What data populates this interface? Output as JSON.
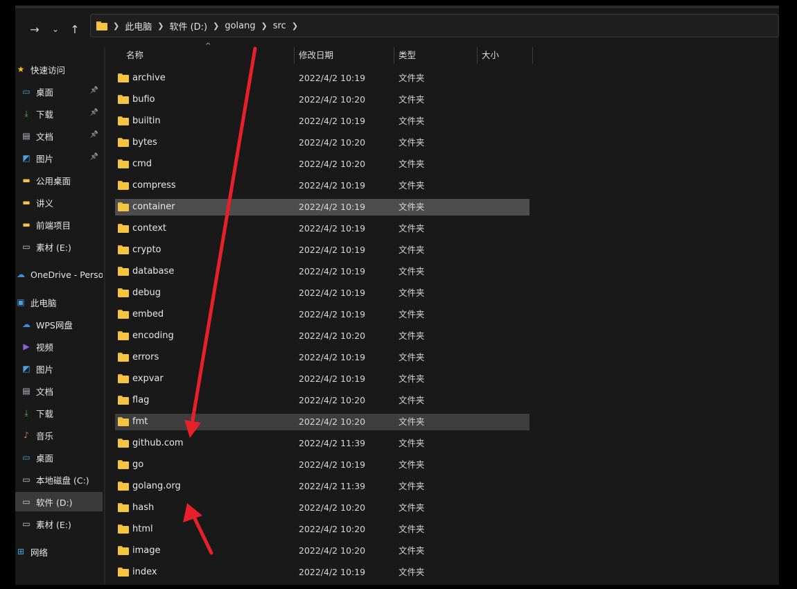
{
  "breadcrumb": [
    "此电脑",
    "软件 (D:)",
    "golang",
    "src"
  ],
  "columns": {
    "name": "名称",
    "modified": "修改日期",
    "type": "类型",
    "size": "大小"
  },
  "sidebar": [
    {
      "label": "快速访问",
      "icon": "star-icon",
      "level": 0,
      "pinned": false
    },
    {
      "label": "桌面",
      "icon": "desktop-icon",
      "level": 1,
      "pinned": true
    },
    {
      "label": "下载",
      "icon": "download-icon",
      "level": 1,
      "pinned": true
    },
    {
      "label": "文档",
      "icon": "document-icon",
      "level": 1,
      "pinned": true
    },
    {
      "label": "图片",
      "icon": "picture-icon",
      "level": 1,
      "pinned": true
    },
    {
      "label": "公用桌面",
      "icon": "folder-icon",
      "level": 1,
      "pinned": false
    },
    {
      "label": "讲义",
      "icon": "folder-icon",
      "level": 1,
      "pinned": false
    },
    {
      "label": "前端项目",
      "icon": "folder-icon",
      "level": 1,
      "pinned": false
    },
    {
      "label": "素材 (E:)",
      "icon": "drive-icon",
      "level": 1,
      "pinned": false
    },
    {
      "label": "OneDrive - Persor",
      "icon": "cloud-icon",
      "level": 0,
      "pinned": false
    },
    {
      "label": "此电脑",
      "icon": "computer-icon",
      "level": 0,
      "pinned": false
    },
    {
      "label": "WPS网盘",
      "icon": "cloud-icon",
      "level": 1,
      "pinned": false
    },
    {
      "label": "视频",
      "icon": "video-icon",
      "level": 1,
      "pinned": false
    },
    {
      "label": "图片",
      "icon": "picture-icon",
      "level": 1,
      "pinned": false
    },
    {
      "label": "文档",
      "icon": "document-icon",
      "level": 1,
      "pinned": false
    },
    {
      "label": "下载",
      "icon": "download-icon",
      "level": 1,
      "pinned": false
    },
    {
      "label": "音乐",
      "icon": "music-icon",
      "level": 1,
      "pinned": false
    },
    {
      "label": "桌面",
      "icon": "desktop-icon",
      "level": 1,
      "pinned": false
    },
    {
      "label": "本地磁盘 (C:)",
      "icon": "drive-icon",
      "level": 1,
      "pinned": false
    },
    {
      "label": "软件 (D:)",
      "icon": "drive-icon",
      "level": 1,
      "pinned": false,
      "selected": true
    },
    {
      "label": "素材 (E:)",
      "icon": "drive-icon",
      "level": 1,
      "pinned": false
    },
    {
      "label": "网络",
      "icon": "network-icon",
      "level": 0,
      "pinned": false
    }
  ],
  "files": [
    {
      "name": "archive",
      "date": "2022/4/2 10:19",
      "type": "文件夹"
    },
    {
      "name": "bufio",
      "date": "2022/4/2 10:20",
      "type": "文件夹"
    },
    {
      "name": "builtin",
      "date": "2022/4/2 10:19",
      "type": "文件夹"
    },
    {
      "name": "bytes",
      "date": "2022/4/2 10:20",
      "type": "文件夹"
    },
    {
      "name": "cmd",
      "date": "2022/4/2 10:20",
      "type": "文件夹"
    },
    {
      "name": "compress",
      "date": "2022/4/2 10:19",
      "type": "文件夹"
    },
    {
      "name": "container",
      "date": "2022/4/2 10:19",
      "type": "文件夹",
      "highlight": "selected"
    },
    {
      "name": "context",
      "date": "2022/4/2 10:19",
      "type": "文件夹"
    },
    {
      "name": "crypto",
      "date": "2022/4/2 10:19",
      "type": "文件夹"
    },
    {
      "name": "database",
      "date": "2022/4/2 10:19",
      "type": "文件夹"
    },
    {
      "name": "debug",
      "date": "2022/4/2 10:19",
      "type": "文件夹"
    },
    {
      "name": "embed",
      "date": "2022/4/2 10:19",
      "type": "文件夹"
    },
    {
      "name": "encoding",
      "date": "2022/4/2 10:20",
      "type": "文件夹"
    },
    {
      "name": "errors",
      "date": "2022/4/2 10:19",
      "type": "文件夹"
    },
    {
      "name": "expvar",
      "date": "2022/4/2 10:19",
      "type": "文件夹"
    },
    {
      "name": "flag",
      "date": "2022/4/2 10:20",
      "type": "文件夹"
    },
    {
      "name": "fmt",
      "date": "2022/4/2 10:20",
      "type": "文件夹",
      "highlight": "hover"
    },
    {
      "name": "github.com",
      "date": "2022/4/2 11:39",
      "type": "文件夹"
    },
    {
      "name": "go",
      "date": "2022/4/2 10:19",
      "type": "文件夹"
    },
    {
      "name": "golang.org",
      "date": "2022/4/2 11:39",
      "type": "文件夹"
    },
    {
      "name": "hash",
      "date": "2022/4/2 10:20",
      "type": "文件夹"
    },
    {
      "name": "html",
      "date": "2022/4/2 10:20",
      "type": "文件夹"
    },
    {
      "name": "image",
      "date": "2022/4/2 10:20",
      "type": "文件夹"
    },
    {
      "name": "index",
      "date": "2022/4/2 10:19",
      "type": "文件夹"
    }
  ],
  "colors": {
    "arrow": "#e8202a",
    "folder": "#f5c443",
    "selected_row": "#4d4d4d"
  }
}
